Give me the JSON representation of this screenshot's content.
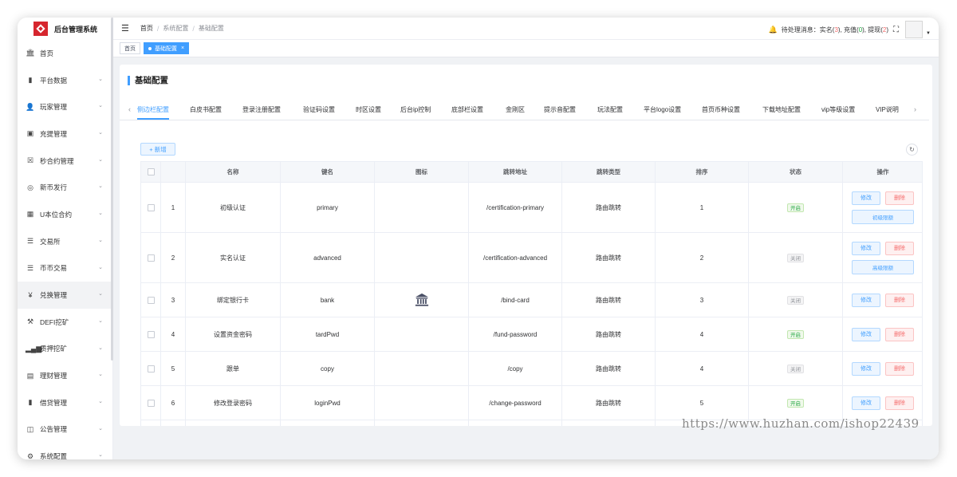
{
  "app": {
    "logo_text": "后台管理系统"
  },
  "sidebar": {
    "items": [
      {
        "label": "首页",
        "icon": "dashboard-icon",
        "glyph": "🏛",
        "arrow": false
      },
      {
        "label": "平台数据",
        "icon": "data-icon",
        "glyph": "▮",
        "arrow": true
      },
      {
        "label": "玩家管理",
        "icon": "user-icon",
        "glyph": "👤",
        "arrow": true
      },
      {
        "label": "充提管理",
        "icon": "wallet-icon",
        "glyph": "▣",
        "arrow": true
      },
      {
        "label": "秒合约管理",
        "icon": "contract-icon",
        "glyph": "☒",
        "arrow": true
      },
      {
        "label": "新币发行",
        "icon": "coin-icon",
        "glyph": "◎",
        "arrow": true
      },
      {
        "label": "U本位合约",
        "icon": "grid-icon",
        "glyph": "▦",
        "arrow": true
      },
      {
        "label": "交易所",
        "icon": "exchange-icon",
        "glyph": "☰",
        "arrow": true
      },
      {
        "label": "币币交易",
        "icon": "list-icon",
        "glyph": "☰",
        "arrow": true
      },
      {
        "label": "兑换管理",
        "icon": "yen-icon",
        "glyph": "¥",
        "arrow": true,
        "active": true
      },
      {
        "label": "DEFI挖矿",
        "icon": "mining-icon",
        "glyph": "⚒",
        "arrow": true
      },
      {
        "label": "质押挖矿",
        "icon": "bar-chart-icon",
        "glyph": "▂▄▆",
        "arrow": true
      },
      {
        "label": "理财管理",
        "icon": "finance-icon",
        "glyph": "▤",
        "arrow": true
      },
      {
        "label": "借贷管理",
        "icon": "loan-icon",
        "glyph": "▮",
        "arrow": true
      },
      {
        "label": "公告管理",
        "icon": "notice-icon",
        "glyph": "◫",
        "arrow": true
      },
      {
        "label": "系统配置",
        "icon": "settings-icon",
        "glyph": "⚙",
        "arrow": true
      }
    ]
  },
  "header": {
    "breadcrumb": [
      "首页",
      "系统配置",
      "基础配置"
    ],
    "pending_label": "待处理消息：",
    "kyc_label": "实名(",
    "kyc_count": "3",
    "recharge_label": "),  充值(",
    "recharge_count": "0",
    "withdraw_label": "),  提现(",
    "withdraw_count": "2",
    "close_paren": ")"
  },
  "tagsbar": {
    "tags": [
      {
        "label": "首页"
      },
      {
        "label": "基础配置",
        "active": true
      }
    ]
  },
  "page": {
    "title": "基础配置"
  },
  "tabs": [
    "侧边栏配置",
    "白皮书配置",
    "登录注册配置",
    "验证码设置",
    "时区设置",
    "后台ip控制",
    "底部栏设置",
    "金刚区",
    "提示音配置",
    "玩法配置",
    "平台logo设置",
    "首页币种设置",
    "下载地址配置",
    "vip等级设置",
    "VIP说明"
  ],
  "toolbar": {
    "add_label": "+ 新增",
    "refresh_icon": "refresh-icon"
  },
  "table": {
    "columns": [
      "",
      "",
      "名称",
      "键名",
      "图标",
      "跳转地址",
      "跳转类型",
      "排序",
      "状态",
      "操作"
    ],
    "edit_label": "修改",
    "delete_label": "删除",
    "rows": [
      {
        "index": "1",
        "name": "初级认证",
        "key": "primary",
        "icon": "",
        "url": "/certification-primary",
        "type": "路由跳转",
        "sort": "1",
        "status": "开启",
        "status_on": true,
        "extra": "初级限额"
      },
      {
        "index": "2",
        "name": "实名认证",
        "key": "advanced",
        "icon": "",
        "url": "/certification-advanced",
        "type": "路由跳转",
        "sort": "2",
        "status": "关闭",
        "status_on": false,
        "extra": "高级限额"
      },
      {
        "index": "3",
        "name": "绑定银行卡",
        "key": "bank",
        "icon": "bank-icon",
        "url": "/bind-card",
        "type": "路由跳转",
        "sort": "3",
        "status": "关闭",
        "status_on": false,
        "extra": ""
      },
      {
        "index": "4",
        "name": "设置资金密码",
        "key": "tardPwd",
        "icon": "",
        "url": "/fund-password",
        "type": "路由跳转",
        "sort": "4",
        "status": "开启",
        "status_on": true,
        "extra": ""
      },
      {
        "index": "5",
        "name": "跟单",
        "key": "copy",
        "icon": "",
        "url": "/copy",
        "type": "路由跳转",
        "sort": "4",
        "status": "关闭",
        "status_on": false,
        "extra": ""
      },
      {
        "index": "6",
        "name": "修改登录密码",
        "key": "loginPwd",
        "icon": "",
        "url": "/change-password",
        "type": "路由跳转",
        "sort": "5",
        "status": "开启",
        "status_on": true,
        "extra": ""
      }
    ]
  },
  "watermark": "https://www.huzhan.com/ishop22439"
}
